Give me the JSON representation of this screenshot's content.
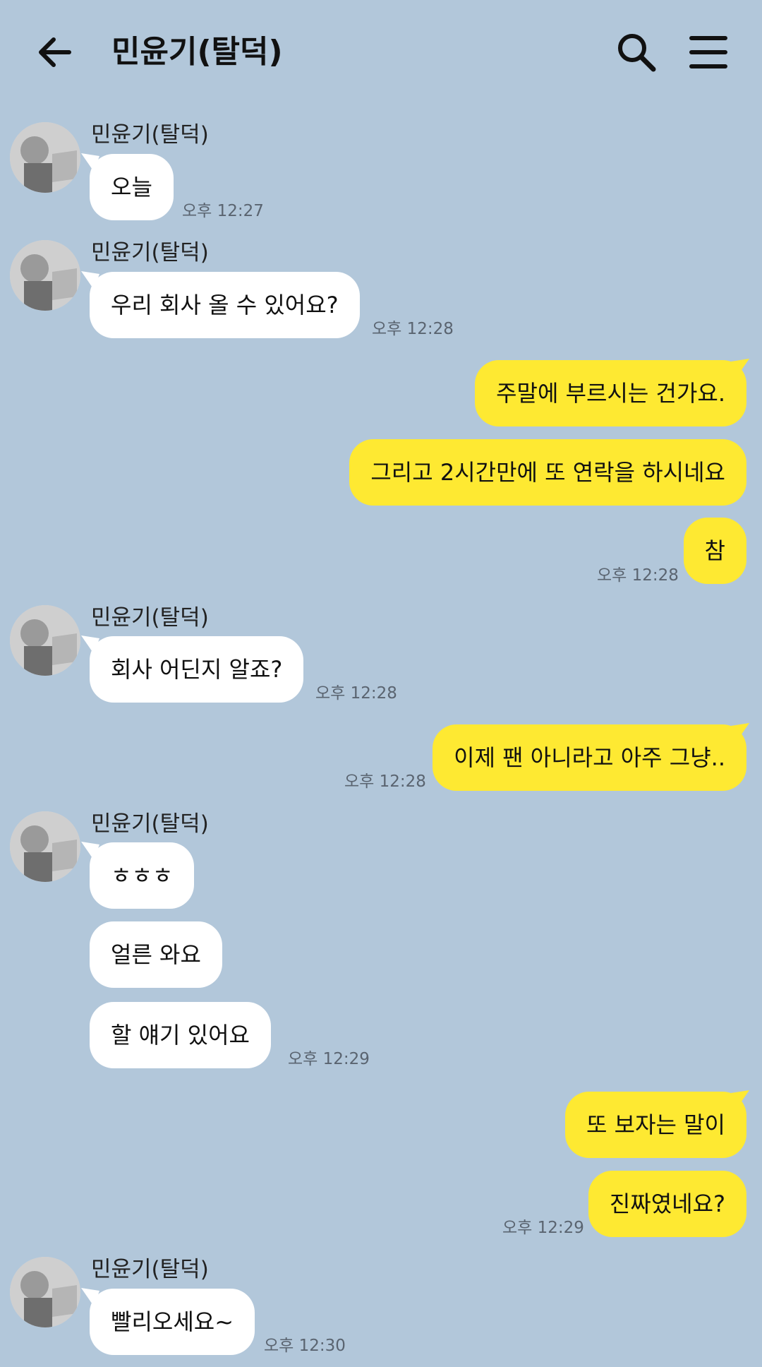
{
  "header": {
    "title": "민윤기(탈덕)"
  },
  "contact": {
    "name": "민윤기(탈덕)"
  },
  "messages": {
    "m1": {
      "text": "오늘",
      "time": "오후 12:27"
    },
    "m2": {
      "text": "우리 회사 올 수 있어요?",
      "time": "오후 12:28"
    },
    "m3": {
      "text": "주말에 부르시는 건가요."
    },
    "m4": {
      "text": "그리고 2시간만에 또 연락을 하시네요"
    },
    "m5": {
      "text": "참",
      "time": "오후 12:28"
    },
    "m6": {
      "text": "회사 어딘지 알죠?",
      "time": "오후 12:28"
    },
    "m7": {
      "text": "이제 팬 아니라고 아주 그냥..",
      "time": "오후 12:28"
    },
    "m8": {
      "text": "ㅎㅎㅎ"
    },
    "m9": {
      "text": "얼른 와요"
    },
    "m10": {
      "text": "할 얘기 있어요",
      "time": "오후 12:29"
    },
    "m11": {
      "text": "또 보자는 말이"
    },
    "m12": {
      "text": "진짜였네요?",
      "time": "오후 12:29"
    },
    "m13": {
      "text": "빨리오세요~",
      "time": "오후 12:30"
    }
  },
  "colors": {
    "background": "#b2c7da",
    "outgoing": "#fee932",
    "incoming": "#ffffff"
  },
  "icons": {
    "back": "arrow-left-icon",
    "search": "search-icon",
    "menu": "hamburger-menu-icon"
  }
}
